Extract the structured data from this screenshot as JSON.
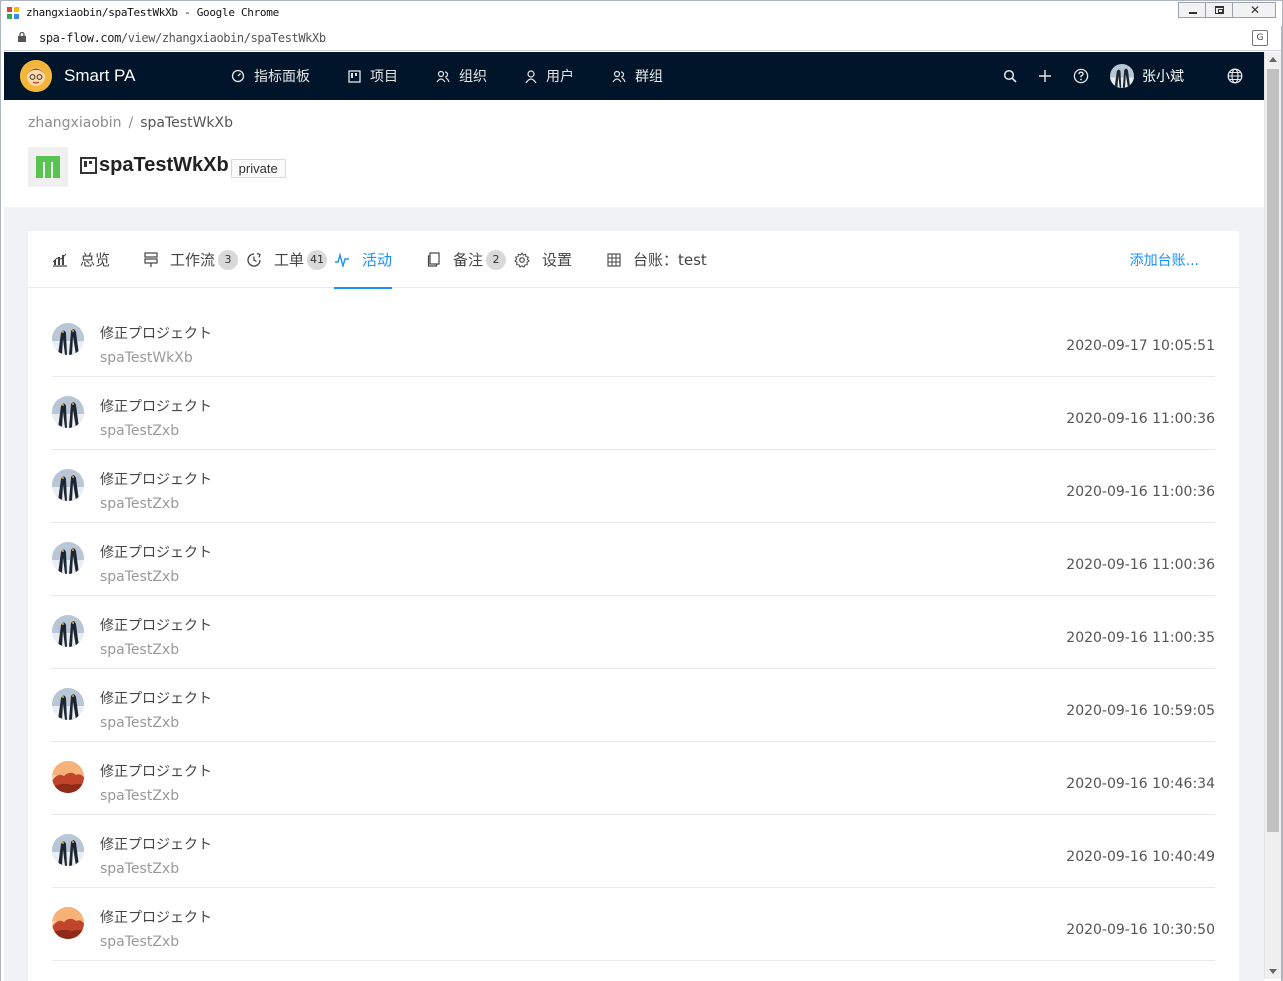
{
  "window": {
    "title": "zhangxiaobin/spaTestWkXb - Google Chrome",
    "url_host": "spa-flow.com",
    "url_path": "/view/zhangxiaobin/spaTestWkXb"
  },
  "nav": {
    "brand": "Smart PA",
    "menu": [
      {
        "label": "指标面板",
        "icon": "dashboard-icon"
      },
      {
        "label": "项目",
        "icon": "project-icon"
      },
      {
        "label": "组织",
        "icon": "team-icon"
      },
      {
        "label": "用户",
        "icon": "user-icon"
      },
      {
        "label": "群组",
        "icon": "group-icon"
      }
    ],
    "username": "张小斌"
  },
  "breadcrumb": {
    "owner": "zhangxiaobin",
    "separator": "/",
    "project": "spaTestWkXb"
  },
  "project": {
    "name": "spaTestWkXb",
    "visibility": "private"
  },
  "tabs": [
    {
      "label": "总览",
      "icon": "bar-chart-icon"
    },
    {
      "label": "工作流",
      "icon": "workflow-icon",
      "count": "3"
    },
    {
      "label": "工单",
      "icon": "ticket-icon",
      "count": "41"
    },
    {
      "label": "活动",
      "icon": "activity-icon",
      "active": true
    },
    {
      "label": "备注",
      "icon": "note-icon",
      "count": "2"
    },
    {
      "label": "设置",
      "icon": "gear-icon"
    },
    {
      "label": "台账：test",
      "icon": "table-icon"
    }
  ],
  "tab_extra": "添加台账...",
  "activities": [
    {
      "action": "修正プロジェクト",
      "target": "spaTestWkXb",
      "time": "2020-09-17 10:05:51",
      "avatar": "penguin"
    },
    {
      "action": "修正プロジェクト",
      "target": "spaTestZxb",
      "time": "2020-09-16 11:00:36",
      "avatar": "penguin"
    },
    {
      "action": "修正プロジェクト",
      "target": "spaTestZxb",
      "time": "2020-09-16 11:00:36",
      "avatar": "penguin"
    },
    {
      "action": "修正プロジェクト",
      "target": "spaTestZxb",
      "time": "2020-09-16 11:00:36",
      "avatar": "penguin"
    },
    {
      "action": "修正プロジェクト",
      "target": "spaTestZxb",
      "time": "2020-09-16 11:00:35",
      "avatar": "penguin"
    },
    {
      "action": "修正プロジェクト",
      "target": "spaTestZxb",
      "time": "2020-09-16 10:59:05",
      "avatar": "penguin"
    },
    {
      "action": "修正プロジェクト",
      "target": "spaTestZxb",
      "time": "2020-09-16 10:46:34",
      "avatar": "desert"
    },
    {
      "action": "修正プロジェクト",
      "target": "spaTestZxb",
      "time": "2020-09-16 10:40:49",
      "avatar": "penguin"
    },
    {
      "action": "修正プロジェクト",
      "target": "spaTestZxb",
      "time": "2020-09-16 10:30:50",
      "avatar": "desert"
    }
  ],
  "colors": {
    "nav_bg": "#001529",
    "accent": "#1890ff",
    "page_bg": "#f0f2f5"
  }
}
